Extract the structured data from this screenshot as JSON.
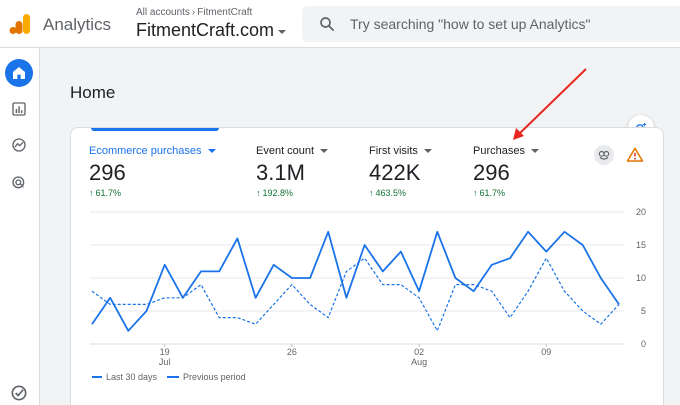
{
  "header": {
    "app_title": "Analytics",
    "breadcrumb": [
      "All accounts",
      "FitmentCraft"
    ],
    "property": "FitmentCraft.com",
    "search_placeholder": "Try searching \"how to set up Analytics\""
  },
  "sidebar": {
    "items": [
      {
        "name": "home",
        "icon": "home-icon",
        "active": true
      },
      {
        "name": "reports",
        "icon": "bar-chart-icon"
      },
      {
        "name": "explore",
        "icon": "explore-icon"
      },
      {
        "name": "advertising",
        "icon": "target-icon"
      }
    ],
    "bottom_icon": "admin-check-icon"
  },
  "page": {
    "title": "Home"
  },
  "metrics": [
    {
      "label": "Ecommerce purchases",
      "value": "296",
      "change": "61.7%",
      "active": true
    },
    {
      "label": "Event count",
      "value": "3.1M",
      "change": "192.8%"
    },
    {
      "label": "First visits",
      "value": "422K",
      "change": "463.5%"
    },
    {
      "label": "Purchases",
      "value": "296",
      "change": "61.7%"
    }
  ],
  "chart_data": {
    "type": "line",
    "x_ticks": [
      {
        "index": 4,
        "day": "19",
        "month": "Jul"
      },
      {
        "index": 11,
        "day": "26",
        "month": ""
      },
      {
        "index": 18,
        "day": "02",
        "month": "Aug"
      },
      {
        "index": 25,
        "day": "09",
        "month": ""
      }
    ],
    "y_ticks": [
      0,
      5,
      10,
      15,
      20
    ],
    "ylim": [
      0,
      20
    ],
    "series": [
      {
        "name": "Last 30 days",
        "style": "solid",
        "values": [
          3,
          7,
          2,
          5,
          12,
          7,
          11,
          11,
          16,
          7,
          12,
          10,
          10,
          17,
          7,
          15,
          11,
          14,
          8,
          17,
          10,
          8,
          12,
          13,
          17,
          14,
          17,
          15,
          10,
          6
        ]
      },
      {
        "name": "Previous period",
        "style": "dashed",
        "values": [
          8,
          6,
          6,
          6,
          7,
          7,
          9,
          4,
          4,
          3,
          6,
          9,
          6,
          4,
          11,
          13,
          9,
          9,
          7,
          2,
          9,
          9,
          8,
          4,
          8,
          13,
          8,
          5,
          3,
          6
        ]
      }
    ],
    "color": "#1a73e8"
  },
  "colors": {
    "accent": "#1a73e8",
    "positive": "#137333",
    "annotation": "#e8261f"
  }
}
